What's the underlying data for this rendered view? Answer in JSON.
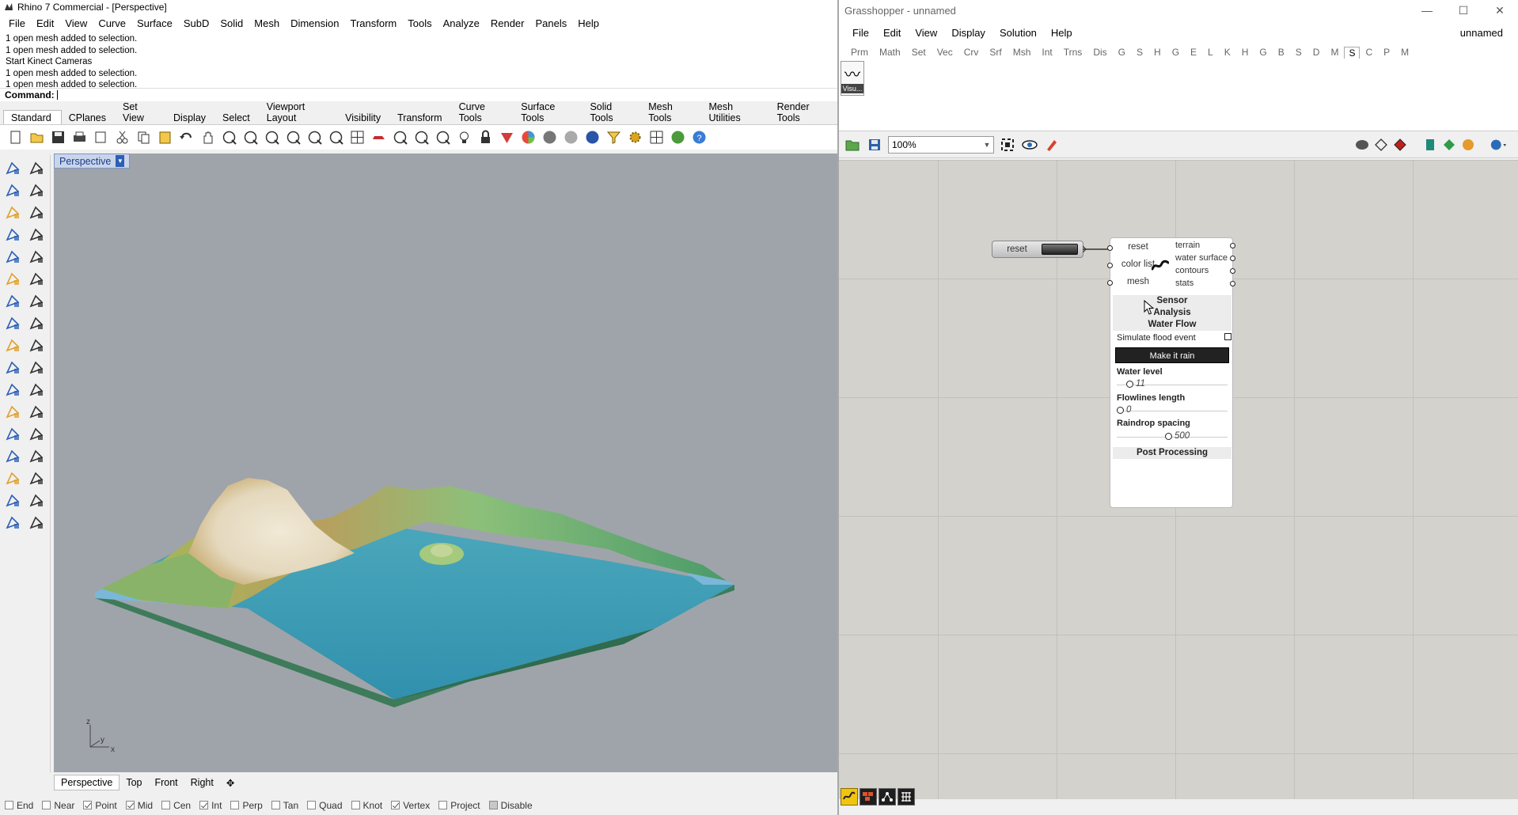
{
  "rhino": {
    "title": "Rhino 7 Commercial - [Perspective]",
    "menu": [
      "File",
      "Edit",
      "View",
      "Curve",
      "Surface",
      "SubD",
      "Solid",
      "Mesh",
      "Dimension",
      "Transform",
      "Tools",
      "Analyze",
      "Render",
      "Panels",
      "Help"
    ],
    "command_history": [
      "1 open mesh added to selection.",
      "1 open mesh added to selection.",
      "Start Kinect Cameras",
      "1 open mesh added to selection.",
      "1 open mesh added to selection."
    ],
    "command_prompt": "Command:",
    "toolbar_tabs": [
      "Standard",
      "CPlanes",
      "Set View",
      "Display",
      "Select",
      "Viewport Layout",
      "Visibility",
      "Transform",
      "Curve Tools",
      "Surface Tools",
      "Solid Tools",
      "Mesh Tools",
      "Mesh Utilities",
      "Render Tools"
    ],
    "active_toolbar_tab": "Standard",
    "toolbar_icons": [
      "new-file-icon",
      "open-file-icon",
      "save-icon",
      "print-icon",
      "export-icon",
      "cut-icon",
      "copy-icon",
      "paste-icon",
      "undo-icon",
      "pan-hand-icon",
      "move-view-icon",
      "zoom-icon",
      "zoom-window-icon",
      "zoom-extents-icon",
      "zoom-selected-icon",
      "rotate-view-icon",
      "four-viewports-icon",
      "car-icon",
      "hide-icon",
      "show-icon",
      "object-properties-icon",
      "light-icon",
      "lock-icon",
      "material-icon",
      "color-wheel-icon",
      "shaded-sphere-icon",
      "rendered-sphere-icon",
      "render-sphere-icon",
      "filter-icon",
      "options-gear-icon",
      "grid-icon",
      "sphere-globe-icon",
      "help-icon"
    ],
    "viewport_label": "Perspective",
    "viewport_tabs": [
      "Perspective",
      "Top",
      "Front",
      "Right"
    ],
    "osnaps": [
      {
        "label": "End",
        "checked": false
      },
      {
        "label": "Near",
        "checked": false
      },
      {
        "label": "Point",
        "checked": true
      },
      {
        "label": "Mid",
        "checked": true
      },
      {
        "label": "Cen",
        "checked": false
      },
      {
        "label": "Int",
        "checked": true
      },
      {
        "label": "Perp",
        "checked": false
      },
      {
        "label": "Tan",
        "checked": false
      },
      {
        "label": "Quad",
        "checked": false
      },
      {
        "label": "Knot",
        "checked": false
      },
      {
        "label": "Vertex",
        "checked": true
      },
      {
        "label": "Project",
        "checked": false
      },
      {
        "label": "Disable",
        "checked": true
      }
    ],
    "axis_labels": {
      "z": "z",
      "x": "x",
      "y": "y"
    }
  },
  "grasshopper": {
    "title": "Grasshopper - unnamed",
    "document_name": "unnamed",
    "menu": [
      "File",
      "Edit",
      "View",
      "Display",
      "Solution",
      "Help"
    ],
    "tabs": [
      "Prm",
      "Math",
      "Set",
      "Vec",
      "Crv",
      "Srf",
      "Msh",
      "Int",
      "Trns",
      "Dis",
      "G",
      "S",
      "H",
      "G",
      "E",
      "L",
      "K",
      "H",
      "G",
      "B",
      "S",
      "D",
      "M",
      "S",
      "C",
      "P",
      "M"
    ],
    "active_tab": "S",
    "component_icon_label": "Visu...",
    "zoom": "100%",
    "reset_node": {
      "label": "reset"
    },
    "component": {
      "inputs": [
        "reset",
        "color list",
        "mesh"
      ],
      "outputs": [
        "terrain",
        "water surface",
        "contours",
        "stats"
      ],
      "sections": [
        "Sensor",
        "Analysis",
        "Water Flow"
      ],
      "flood_label": "Simulate flood event",
      "flood_checked": false,
      "rain_button": "Make it rain",
      "sliders": [
        {
          "label": "Water level",
          "value": "11",
          "fraction": 0.09
        },
        {
          "label": "Flowlines length",
          "value": "0",
          "fraction": 0.0
        },
        {
          "label": "Raindrop spacing",
          "value": "500",
          "fraction": 0.47
        }
      ],
      "post_processing": "Post Processing"
    },
    "bottom_icons": [
      "sensor-icon",
      "bricks-icon",
      "network-icon",
      "grid-pattern-icon"
    ]
  },
  "colors": {
    "viewport_bg": "#9fa4aa",
    "terrain_sand": "#e9dfc8",
    "terrain_green": "#7fb26b",
    "water": "#3d9fb5",
    "water_edge": "#7bb7d8",
    "gh_canvas": "#d4d2cc"
  }
}
